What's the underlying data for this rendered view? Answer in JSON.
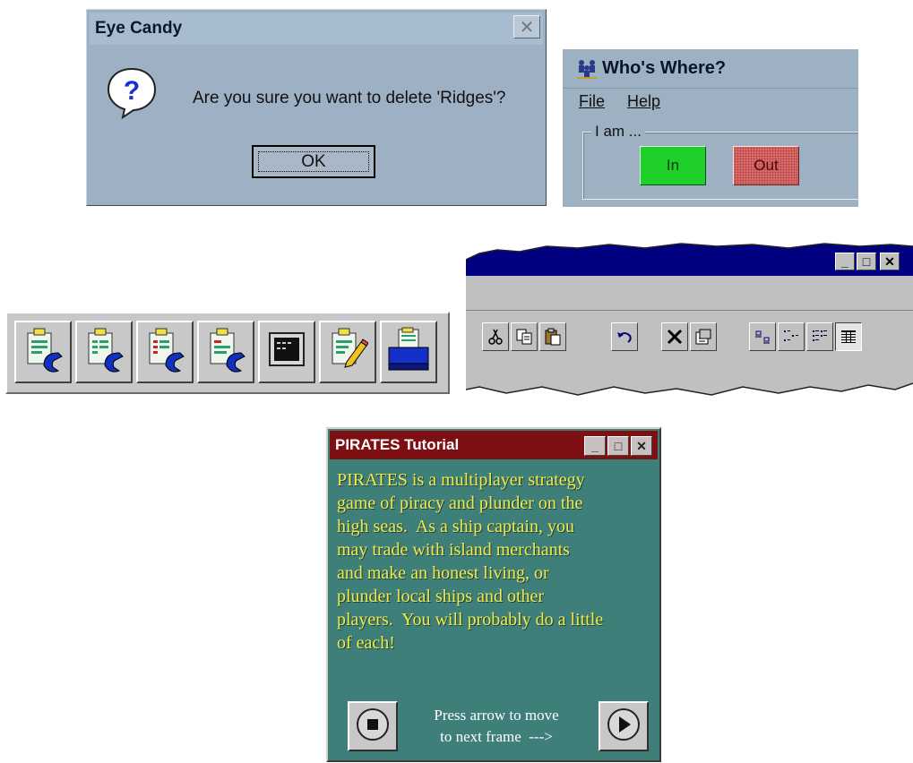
{
  "eye_candy": {
    "title": "Eye Candy",
    "close_glyph": "✕",
    "icon": "question-icon",
    "message": "Are you sure you want to delete 'Ridges'?",
    "ok_label": "OK"
  },
  "whos_where": {
    "title": "Who's Where?",
    "icon": "people-icon",
    "menu": [
      {
        "label": "File"
      },
      {
        "label": "Help"
      }
    ],
    "group_label": "I am ...",
    "in_label": "In",
    "out_label": "Out",
    "colors": {
      "in": "#1fcf2a",
      "out": "#d86b6b"
    }
  },
  "toolbar_left": {
    "buttons": [
      {
        "icon": "clipboard-phone-icon"
      },
      {
        "icon": "clipboard-phone-icon"
      },
      {
        "icon": "clipboard-phone-red-icon"
      },
      {
        "icon": "clipboard-phone-icon"
      },
      {
        "icon": "terminal-icon"
      },
      {
        "icon": "clipboard-pencil-icon"
      },
      {
        "icon": "printer-icon"
      }
    ]
  },
  "torn_window": {
    "window_buttons": [
      {
        "icon": "minimize-icon",
        "glyph": "_"
      },
      {
        "icon": "maximize-icon",
        "glyph": "□"
      },
      {
        "icon": "close-icon",
        "glyph": "✕"
      }
    ],
    "toolbar": [
      {
        "icon": "cut-icon"
      },
      {
        "icon": "copy-icon"
      },
      {
        "icon": "paste-icon"
      },
      {
        "icon": "undo-icon"
      },
      {
        "icon": "delete-icon"
      },
      {
        "icon": "properties-icon"
      },
      {
        "icon": "large-icons-view-icon"
      },
      {
        "icon": "small-icons-view-icon"
      },
      {
        "icon": "list-view-icon"
      },
      {
        "icon": "details-view-icon"
      }
    ],
    "title_color": "#000080"
  },
  "pirates": {
    "title": "PIRATES Tutorial",
    "window_buttons": [
      {
        "icon": "minimize-icon",
        "glyph": "_"
      },
      {
        "icon": "maximize-icon",
        "glyph": "□"
      },
      {
        "icon": "close-icon",
        "glyph": "✕"
      }
    ],
    "body_lines": [
      "PIRATES is a multiplayer strategy",
      "game of piracy and plunder on the",
      "high seas.  As a ship captain, you",
      "may trade with island merchants",
      "and make an honest living, or",
      "plunder local ships and other",
      "players.  You will probably do a little",
      "of each!"
    ],
    "hint_lines": [
      "Press arrow to move",
      "to next frame  --->"
    ],
    "title_color": "#7e0f12",
    "text_color": "#f2ea4a",
    "background_color": "#3f7f7a"
  }
}
